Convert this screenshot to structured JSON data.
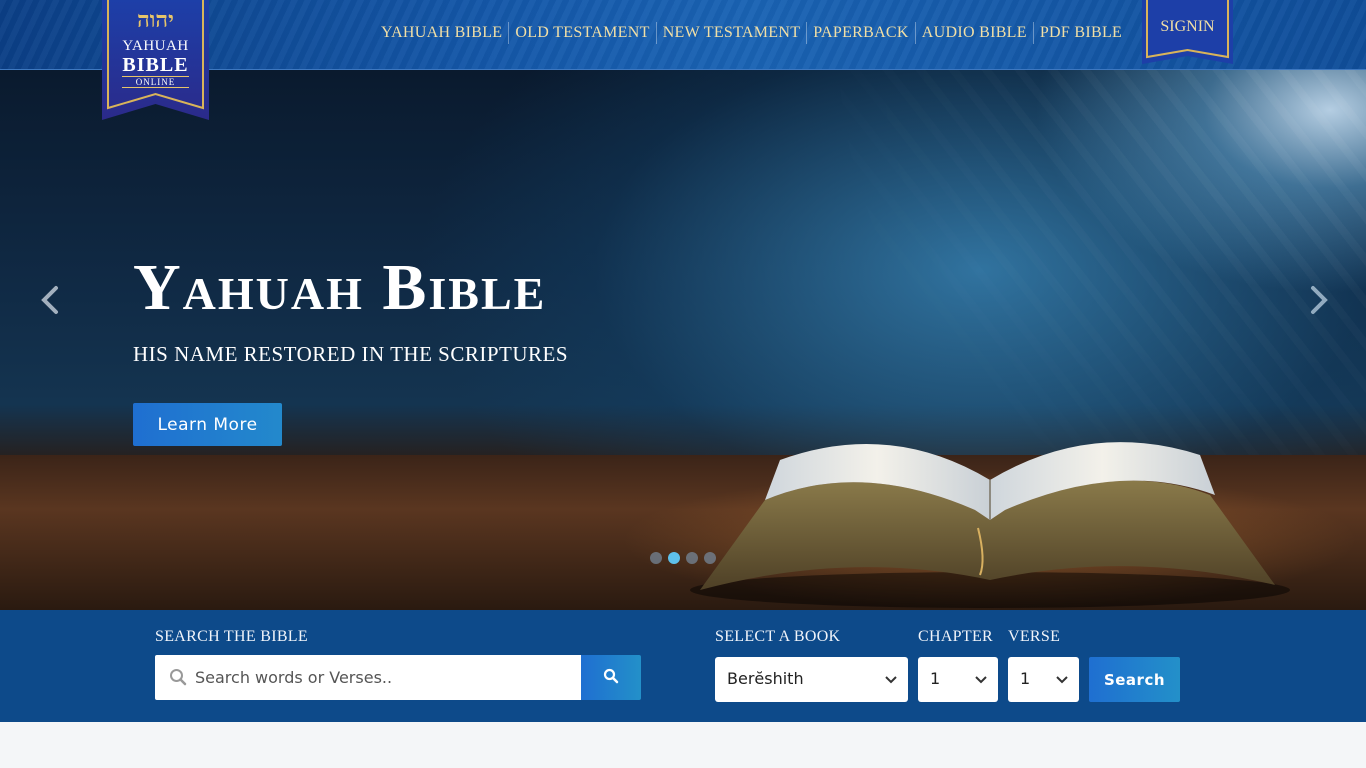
{
  "brand": {
    "hebrew": "יהוה",
    "line1": "YAHUAH",
    "line2": "BIBLE",
    "line3": "ONLINE"
  },
  "nav": {
    "items": [
      "YAHUAH BIBLE",
      "OLD TESTAMENT",
      "NEW TESTAMENT",
      "PAPERBACK",
      "AUDIO BIBLE",
      "PDF BIBLE"
    ],
    "signin": "SIGNIN"
  },
  "hero": {
    "title": "Yahuah Bible",
    "subtitle": "HIS NAME RESTORED IN THE SCRIPTURES",
    "button": "Learn More",
    "slides_total": 4,
    "active_slide": 2
  },
  "search": {
    "label": "SEARCH THE BIBLE",
    "placeholder": "Search words or Verses..",
    "value": ""
  },
  "lookup": {
    "book_label": "SELECT A BOOK",
    "chapter_label": "CHAPTER",
    "verse_label": "VERSE",
    "book_value": "Berĕshith",
    "chapter_value": "1",
    "verse_value": "1",
    "button": "Search"
  },
  "colors": {
    "header": "#1457a8",
    "nav_text": "#f1dfa6",
    "accent": "#1f6fd1",
    "search_bg": "#0d4a8a",
    "active_dot": "#5ec0ea"
  }
}
